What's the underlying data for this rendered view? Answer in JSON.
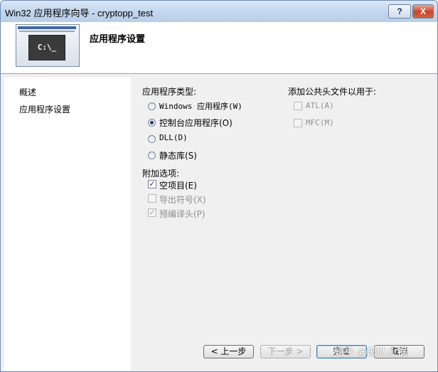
{
  "window": {
    "title": "Win32 应用程序向导 - cryptopp_test",
    "help": "?",
    "close": "X"
  },
  "header": {
    "page_title": "应用程序设置",
    "logo_text": "C:\\_"
  },
  "sidebar": {
    "items": [
      "概述",
      "应用程序设置"
    ]
  },
  "app_type": {
    "heading": "应用程序类型:",
    "options": [
      {
        "label": "Windows 应用程序(W)",
        "checked": false
      },
      {
        "label": "控制台应用程序(O)",
        "checked": true
      },
      {
        "label": "DLL(D)",
        "checked": false
      },
      {
        "label": "静态库(S)",
        "checked": false
      }
    ]
  },
  "extra": {
    "heading": "附加选项:",
    "options": [
      {
        "label": "空项目(E)",
        "checked": true,
        "enabled": true
      },
      {
        "label": "导出符号(X)",
        "checked": false,
        "enabled": false
      },
      {
        "label": "预编译头(P)",
        "checked": true,
        "enabled": false
      }
    ]
  },
  "common_headers": {
    "heading": "添加公共头文件以用于:",
    "options": [
      {
        "label": "ATL(A)",
        "checked": false,
        "enabled": false
      },
      {
        "label": "MFC(M)",
        "checked": false,
        "enabled": false
      }
    ]
  },
  "footer": {
    "prev": "< 上一步",
    "next": "下一步 >",
    "finish": "完成",
    "cancel": "取消",
    "watermark": "知乎 @部队火锅"
  }
}
